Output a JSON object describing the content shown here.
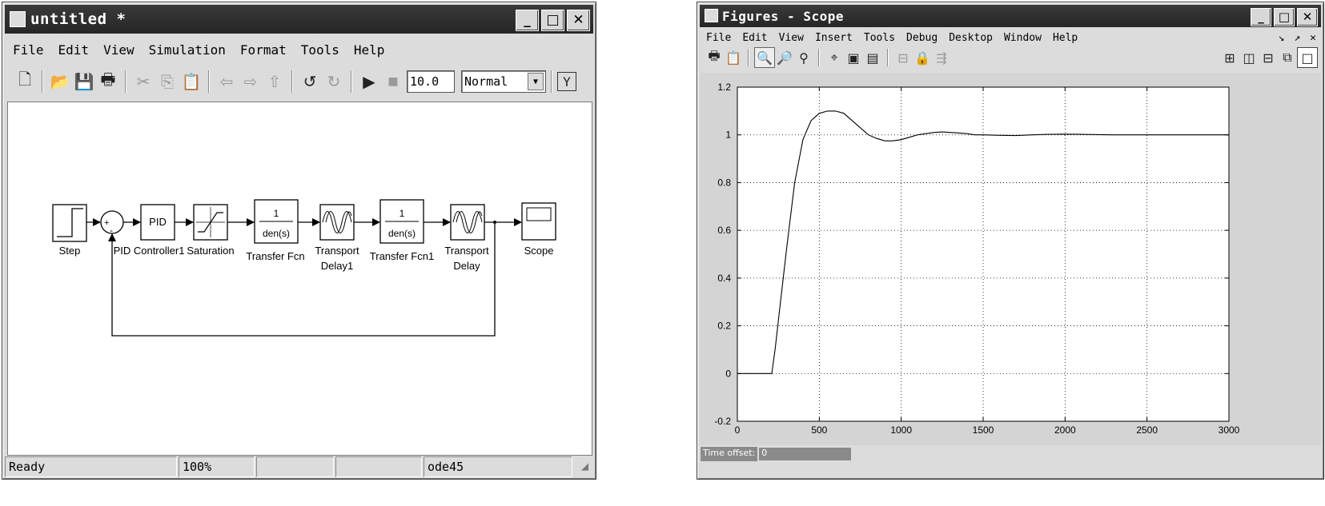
{
  "simulink": {
    "title": "untitled *",
    "menu": [
      "File",
      "Edit",
      "View",
      "Simulation",
      "Format",
      "Tools",
      "Help"
    ],
    "stop_time": "10.0",
    "sim_mode": "Normal",
    "toolbar_icons": [
      "new-icon",
      "open-icon",
      "save-icon",
      "print-icon",
      "cut-icon",
      "copy-icon",
      "paste-icon",
      "back-icon",
      "forward-icon",
      "up-icon",
      "undo-icon",
      "redo-icon",
      "play-icon",
      "stop-icon",
      "library-icon"
    ],
    "blocks": {
      "step": "Step",
      "pid_text": "PID",
      "pid": "PID Controller1",
      "saturation": "Saturation",
      "tf1_num": "1",
      "tf1_den": "den(s)",
      "tf1": "Transfer Fcn",
      "delay1_l1": "Transport",
      "delay1_l2": "Delay1",
      "tf2_num": "1",
      "tf2_den": "den(s)",
      "tf2": "Transfer Fcn1",
      "delay_l1": "Transport",
      "delay_l2": "Delay",
      "scope": "Scope",
      "sum_plus": "+",
      "sum_minus": "-"
    },
    "status": {
      "state": "Ready",
      "zoom": "100%",
      "solver": "ode45"
    }
  },
  "figure": {
    "title": "Figures - Scope",
    "menu": [
      "File",
      "Edit",
      "View",
      "Insert",
      "Tools",
      "Debug",
      "Desktop",
      "Window",
      "Help"
    ],
    "time_offset_label": "Time offset:",
    "time_offset_value": "0",
    "toolbar_icons": [
      "print-icon",
      "copy-figure-icon",
      "zoom-in-icon",
      "zoom-out-icon",
      "zoom-icon",
      "data-cursor-icon",
      "save-icon",
      "save-as-icon",
      "float-icon",
      "lock-icon",
      "signal-select-icon",
      "tile-icon",
      "rows-icon",
      "cols-icon",
      "restore-icon",
      "maximize-icon"
    ]
  },
  "chart_data": {
    "type": "line",
    "title": "",
    "xlabel": "",
    "ylabel": "",
    "xlim": [
      0,
      3000
    ],
    "ylim": [
      -0.2,
      1.2
    ],
    "xticks": [
      0,
      500,
      1000,
      1500,
      2000,
      2500,
      3000
    ],
    "yticks": [
      -0.2,
      0,
      0.2,
      0.4,
      0.6,
      0.8,
      1,
      1.2
    ],
    "xtick_labels": [
      "0",
      "500",
      "1000",
      "1500",
      "2000",
      "2500",
      "3000"
    ],
    "ytick_labels": [
      "-0.2",
      "0",
      "0.2",
      "0.4",
      "0.6",
      "0.8",
      "1",
      "1.2"
    ],
    "grid": true,
    "series": [
      {
        "x": [
          0,
          210,
          230,
          260,
          300,
          350,
          400,
          450,
          500,
          550,
          600,
          650,
          700,
          750,
          800,
          850,
          900,
          950,
          1000,
          1050,
          1100,
          1150,
          1200,
          1250,
          1300,
          1350,
          1400,
          1450,
          1500,
          1600,
          1700,
          1800,
          1900,
          2000,
          2100,
          2200,
          2300,
          2500,
          3000
        ],
        "y": [
          0,
          0,
          0.1,
          0.28,
          0.52,
          0.8,
          0.98,
          1.06,
          1.09,
          1.1,
          1.1,
          1.09,
          1.06,
          1.03,
          1.0,
          0.985,
          0.975,
          0.975,
          0.98,
          0.99,
          1.0,
          1.005,
          1.01,
          1.012,
          1.01,
          1.008,
          1.005,
          1.0,
          1.0,
          0.998,
          0.997,
          1.0,
          1.002,
          1.003,
          1.002,
          1.001,
          1.0,
          1.0,
          1.0
        ]
      }
    ]
  }
}
